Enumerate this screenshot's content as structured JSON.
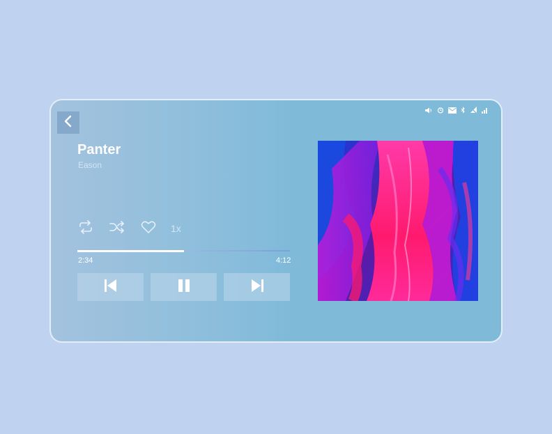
{
  "track": {
    "title": "Panter",
    "artist": "Eason",
    "speed": "1x",
    "elapsed": "2:34",
    "duration": "4:12",
    "progress_fraction": 0.5
  },
  "icons": {
    "back": "chevron-left-icon",
    "repeat": "repeat-icon",
    "shuffle": "shuffle-icon",
    "favorite": "heart-icon",
    "previous": "skip-previous-icon",
    "pause": "pause-icon",
    "next": "skip-next-icon",
    "status": [
      "volume-icon",
      "alarm-icon",
      "mail-icon",
      "bluetooth-icon",
      "no-signal-icon",
      "signal-bars-icon"
    ]
  },
  "colors": {
    "page_background": "#bfd3f0",
    "card_background": "#7fbad9",
    "accent_pink": "#ff1a6e",
    "accent_blue": "#1b3bd8"
  }
}
